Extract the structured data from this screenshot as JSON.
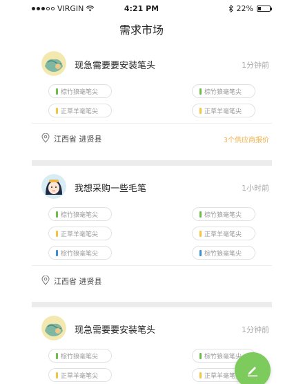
{
  "status_bar": {
    "carrier": "VIRGIN",
    "time": "4:21 PM",
    "battery": "22%",
    "battery_level": 0.22
  },
  "nav": {
    "title": "需求市场"
  },
  "colors": {
    "green": "#6dbd4a",
    "yellow": "#f5c542",
    "blue": "#3a8fd9",
    "quote": "#f0b14a",
    "fab": "#7ecb5d"
  },
  "cards": [
    {
      "title": "现急需要要安装笔头",
      "time": "1分钟前",
      "tags": [
        [
          {
            "label": "棕竹狼毫笔尖",
            "color": "green"
          },
          {
            "label": "棕竹狼毫笔尖",
            "color": "green"
          }
        ],
        [
          {
            "label": "正草羊毫笔尖",
            "color": "yellow"
          },
          {
            "label": "正草羊毫笔尖",
            "color": "yellow"
          }
        ]
      ],
      "location": "江西省 进贤县",
      "quote": "3个供应商报价"
    },
    {
      "title": "我想采购一些毛笔",
      "time": "1小时前",
      "tags": [
        [
          {
            "label": "棕竹狼毫笔尖",
            "color": "green"
          },
          {
            "label": "棕竹狼毫笔尖",
            "color": "green"
          }
        ],
        [
          {
            "label": "正草羊毫笔尖",
            "color": "yellow"
          },
          {
            "label": "正草羊毫笔尖",
            "color": "yellow"
          }
        ],
        [
          {
            "label": "棕竹狼毫笔尖",
            "color": "blue"
          },
          {
            "label": "棕竹狼毫笔尖",
            "color": "blue"
          }
        ]
      ],
      "location": "江西省 进贤县",
      "quote": ""
    },
    {
      "title": "现急需要要安装笔头",
      "time": "1分钟前",
      "tags": [
        [
          {
            "label": "棕竹狼毫笔尖",
            "color": "green"
          },
          {
            "label": "棕竹狼毫笔尖",
            "color": "green"
          }
        ],
        [
          {
            "label": "正草羊毫笔尖",
            "color": "yellow"
          },
          {
            "label": "正草羊毫笔尖",
            "color": "yellow"
          }
        ]
      ]
    }
  ],
  "icons": {
    "location": "location-pin-icon",
    "compose": "pencil-icon"
  }
}
